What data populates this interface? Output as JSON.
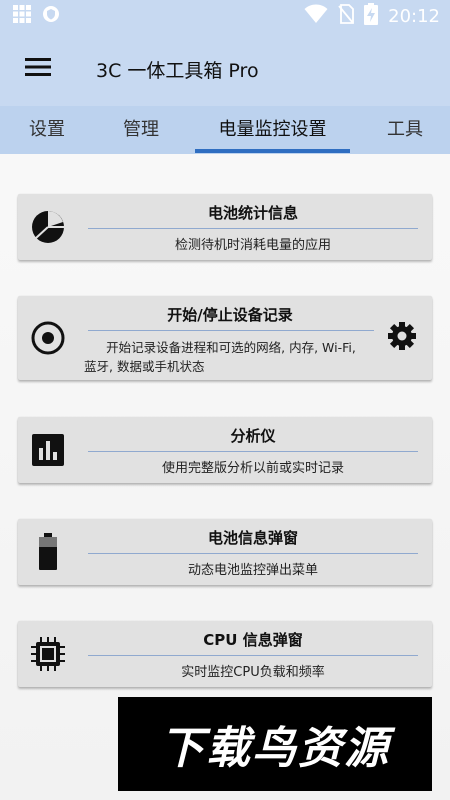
{
  "status_bar": {
    "time": "20:12",
    "left_icons": [
      "grid-icon",
      "shield-icon"
    ],
    "right_icons": [
      "wifi-icon",
      "no-sim-icon",
      "battery-charging-icon"
    ]
  },
  "app_bar": {
    "title": "3C 一体工具箱 Pro",
    "menu_icon": "hamburger-menu-icon",
    "background": "#c7d9f1"
  },
  "tabs": {
    "items": [
      {
        "label": "设置"
      },
      {
        "label": "管理"
      },
      {
        "label": "电量监控设置"
      },
      {
        "label": "工具"
      }
    ],
    "active": "电量监控设置",
    "indicator_color": "#2f6ec1"
  },
  "cards": [
    {
      "icon": "pie-chart-icon",
      "title": "电池统计信息",
      "desc": "检测待机时消耗电量的应用"
    },
    {
      "icon": "record-icon",
      "title": "开始/停止设备记录",
      "desc_line1": "开始记录设备进程和可选的网络, 内存, Wi-Fi,",
      "desc_line2": "蓝牙, 数据或手机状态",
      "action_icon": "gear-icon"
    },
    {
      "icon": "bar-chart-icon",
      "title": "分析仪",
      "desc": "使用完整版分析以前或实时记录"
    },
    {
      "icon": "battery-icon",
      "title": "电池信息弹窗",
      "desc": "动态电池监控弹出菜单"
    },
    {
      "icon": "cpu-chip-icon",
      "title": "CPU 信息弹窗",
      "desc": "实时监控CPU负载和频率"
    }
  ],
  "watermark": {
    "text": "下载鸟资源"
  }
}
